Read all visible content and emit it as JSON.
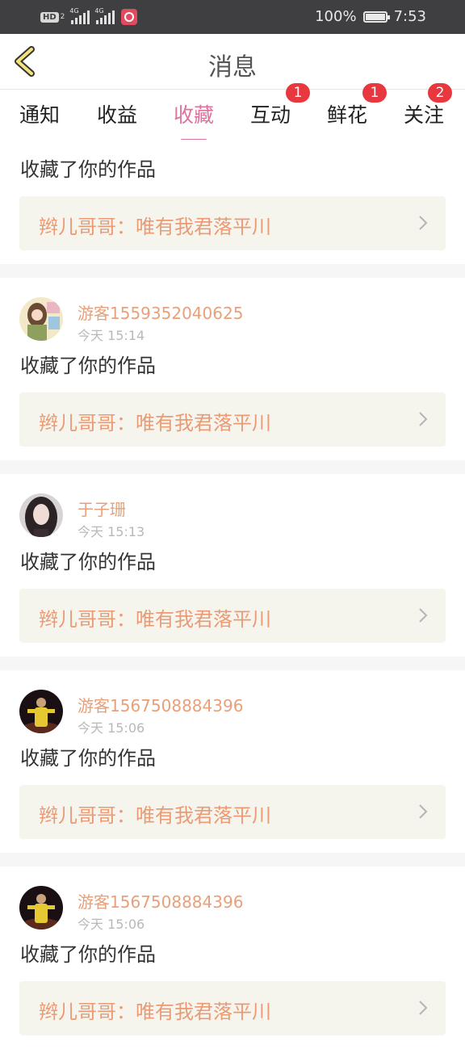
{
  "status_bar": {
    "hd_label": "HD",
    "hd_sub": "2",
    "signal1_label": "4G",
    "signal2_label": "4G",
    "battery_percent": "100%",
    "time": "7:53"
  },
  "header": {
    "title": "消息"
  },
  "tabs": [
    {
      "label": "通知",
      "badge": ""
    },
    {
      "label": "收益",
      "badge": ""
    },
    {
      "label": "收藏",
      "badge": "",
      "active": true
    },
    {
      "label": "互动",
      "badge": "1"
    },
    {
      "label": "鲜花",
      "badge": "1"
    },
    {
      "label": "关注",
      "badge": "2"
    }
  ],
  "first_item": {
    "action": "收藏了你的作品",
    "work": "辫儿哥哥：唯有我君落平川"
  },
  "items": [
    {
      "user": "游客1559352040625",
      "time": "今天 15:14",
      "action": "收藏了你的作品",
      "work": "辫儿哥哥：唯有我君落平川"
    },
    {
      "user": "于子珊",
      "time": "今天 15:13",
      "action": "收藏了你的作品",
      "work": "辫儿哥哥：唯有我君落平川"
    },
    {
      "user": "游客1567508884396",
      "time": "今天 15:06",
      "action": "收藏了你的作品",
      "work": "辫儿哥哥：唯有我君落平川"
    },
    {
      "user": "游客1567508884396",
      "time": "今天 15:06",
      "action": "收藏了你的作品",
      "work": "辫儿哥哥：唯有我君落平川"
    }
  ],
  "colors": {
    "accent": "#e0719f",
    "link_text": "#eb9a74",
    "username": "#e8a07a",
    "badge": "#e8383f",
    "link_box_bg": "#f5f5ee"
  }
}
